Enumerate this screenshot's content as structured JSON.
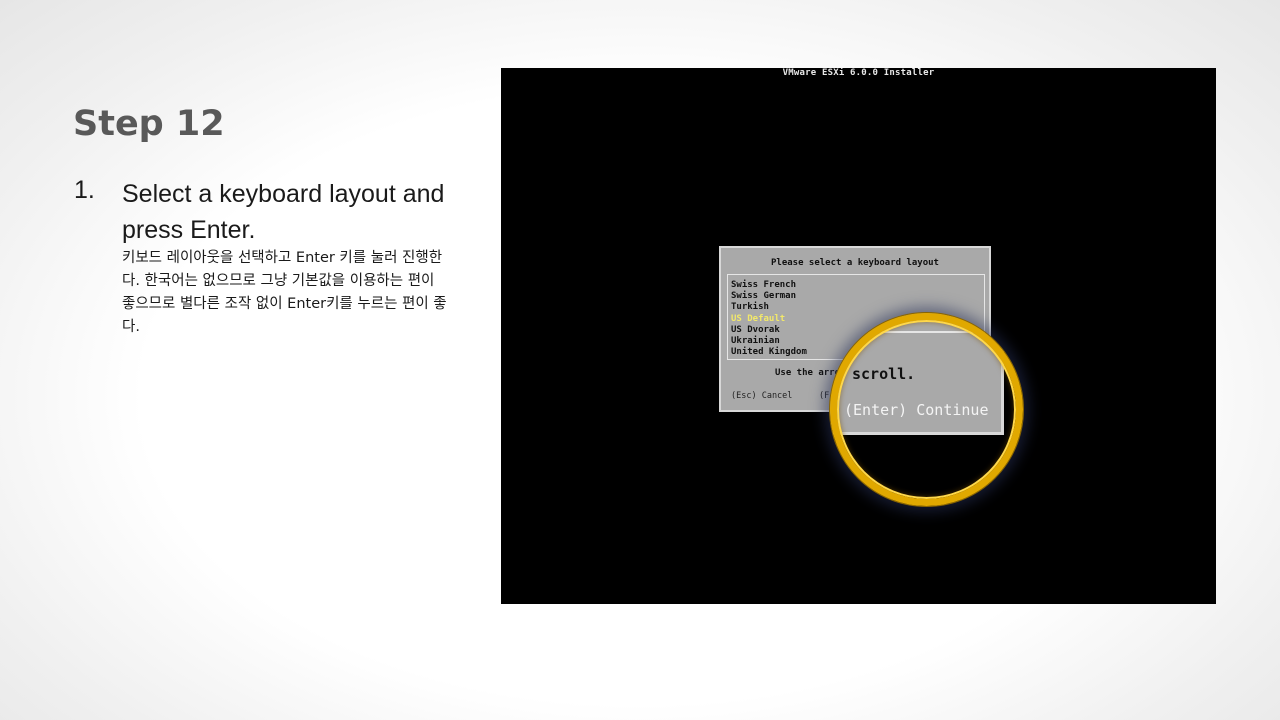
{
  "slide": {
    "title": "Step 12",
    "step_number": "1.",
    "step_text": "Select a keyboard layout and press Enter.",
    "step_note": "키보드 레이아웃을 선택하고 Enter 키를 눌러 진행한다. 한국어는 없으므로 그냥 기본값을 이용하는 편이 좋으므로 별다른 조작 없이 Enter키를 누르는 편이 좋다."
  },
  "installer": {
    "title": "VMware ESXi 6.0.0 Installer",
    "dialog": {
      "title": "Please select a keyboard layout",
      "layouts": [
        "Swiss French",
        "Swiss German",
        "Turkish",
        "US Default",
        "US Dvorak",
        "Ukrainian",
        "United Kingdom"
      ],
      "selected": "US Default",
      "hint": "Use the arro",
      "cancel_label": "(Esc) Cancel",
      "partial_label": "(F"
    },
    "magnifier": {
      "hint_fragment": "scroll.",
      "continue_label": "(Enter) Continue"
    }
  },
  "colors": {
    "title_gray": "#595959",
    "screen_bg": "#000000",
    "dialog_bg": "#a9a9a9",
    "selected_item": "#f2e86a",
    "ring": "#e0a800"
  }
}
